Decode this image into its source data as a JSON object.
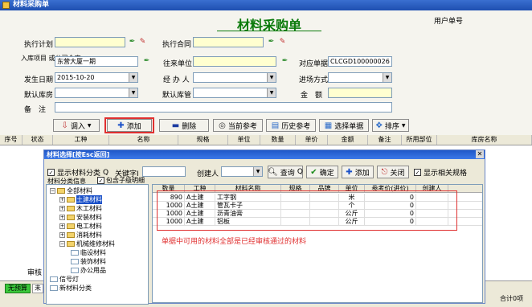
{
  "window": {
    "title": "材料采购单"
  },
  "header": {
    "title": "材料采购单",
    "user_label": "用户单号"
  },
  "form": {
    "plan_label": "执行计划",
    "contract_label": "执行合同",
    "project_label": "入库项目 或公司仓库",
    "project_value": "东营大厦一期",
    "supplier_label": "往来单位",
    "doc_no_label": "对应单据",
    "doc_no_value": "CLCGD100000026",
    "date_label": "发生日期",
    "date_value": "2015-10-20",
    "handler_label": "经 办 人",
    "method_label": "进场方式",
    "warehouse_label": "默认库房",
    "keeper_label": "默认库管",
    "amount_label": "金　额",
    "remark_label": "备　注"
  },
  "toolbar": {
    "import": "调入",
    "add": "添加",
    "delete": "删除",
    "current_ref": "当前参考",
    "history_ref": "历史参考",
    "select_doc": "选择单据",
    "sort": "排序"
  },
  "grid": {
    "columns": [
      "序号",
      "状态",
      "工种",
      "名称",
      "规格",
      "单位",
      "数量",
      "单价",
      "金额",
      "备注",
      "所用部位",
      "库房名称"
    ]
  },
  "dialog": {
    "title": "材料选择[按Esc返回]",
    "show_category": "显示材料分类",
    "show_category_key": "Q",
    "keyword_label": "关键字",
    "keyword_key": "I",
    "creator_label": "创建人",
    "query": "查询",
    "query_key": "Q",
    "confirm": "确定",
    "add": "添加",
    "close": "关闭",
    "show_spec": "显示相关规格",
    "category_info": "材料分类信息",
    "include_sub": "包含子级明细",
    "columns": [
      "数量",
      "工种",
      "材料名称",
      "规格",
      "品牌",
      "单位",
      "参考价(进价)",
      "创建人"
    ],
    "rows": [
      {
        "qty": "890",
        "trade": "A土建",
        "name": "工字钢",
        "spec": "",
        "brand": "",
        "unit": "米",
        "price": "0",
        "creator": ""
      },
      {
        "qty": "1000",
        "trade": "A土建",
        "name": "管瓦卡子",
        "spec": "",
        "brand": "",
        "unit": "个",
        "price": "0",
        "creator": ""
      },
      {
        "qty": "1000",
        "trade": "A土建",
        "name": "沥青油膏",
        "spec": "",
        "brand": "",
        "unit": "公斤",
        "price": "0",
        "creator": ""
      },
      {
        "qty": "1000",
        "trade": "A土建",
        "name": "铝板",
        "spec": "",
        "brand": "",
        "unit": "公斤",
        "price": "0",
        "creator": ""
      }
    ],
    "note": "单据中可用的材料全部是已经审核通过的材料",
    "tree": {
      "root": "全部材料",
      "items": [
        "土建材料",
        "木工材料",
        "安装材料",
        "电工材料",
        "消耗材料",
        "机械维修材料"
      ],
      "sub_items": [
        "临设材料",
        "装饰材料",
        "办公用品"
      ],
      "extra": [
        "信号灯",
        "新材料分类"
      ]
    }
  },
  "footer": {
    "audit_label": "审核",
    "no_budget": "无预算",
    "partial": "未",
    "total": "合计0项"
  }
}
